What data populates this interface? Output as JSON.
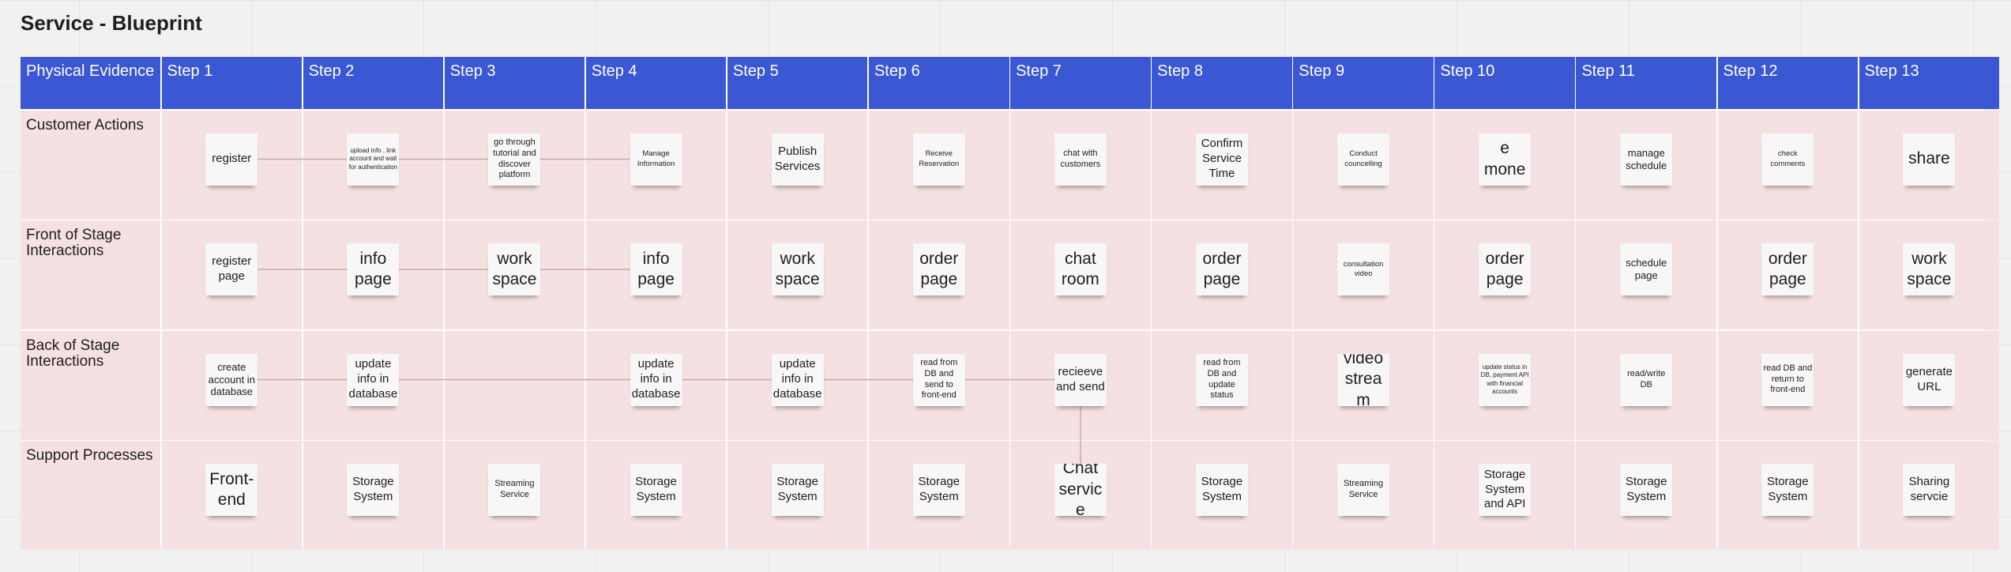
{
  "title": "Service - Blueprint",
  "corner_label": "Physical Evidence",
  "steps": [
    "Step 1",
    "Step 2",
    "Step 3",
    "Step 4",
    "Step 5",
    "Step 6",
    "Step 7",
    "Step 8",
    "Step 9",
    "Step 10",
    "Step 11",
    "Step 12",
    "Step 13"
  ],
  "rows": [
    {
      "label": "Customer Actions",
      "notes": [
        "register",
        "upload info , link account and wait for authentication",
        "go through tutorial and discover platform",
        "Manage Information",
        "Publish Services",
        "Receive Reservation",
        "chat with customers",
        "Confirm Service Time",
        "Conduct councelling",
        "receive money",
        "manage schedule",
        "check comments",
        "share"
      ]
    },
    {
      "label": "Front of Stage Interactions",
      "notes": [
        "register page",
        "info page",
        "work space",
        "info page",
        "work space",
        "order page",
        "chat room",
        "order page",
        "consultation video",
        "order page",
        "schedule page",
        "order page",
        "work space"
      ]
    },
    {
      "label": "Back of Stage Interactions",
      "notes": [
        "create account in database",
        "update info in database",
        "",
        "update info in database",
        "update info in database",
        "read from DB and send to front-end",
        "recieeve and send",
        "read from DB and update status",
        "video stream",
        "update status in DB, payment API with financial accounts",
        "read/write DB",
        "read DB and return to front-end",
        "generate URL"
      ]
    },
    {
      "label": "Support Processes",
      "notes": [
        "Front-end",
        "Storage System",
        "Streaming Service",
        "Storage System",
        "Storage System",
        "Storage System",
        "Chat service",
        "Storage System",
        "Streaming Service",
        "Storage System and API",
        "Storage System",
        "Storage System",
        "Sharing servcie"
      ]
    }
  ],
  "colors": {
    "header": "#3b57d3",
    "lane": "#f5e1e1",
    "note": "#f7f7f7",
    "connector": "#c9a8a8"
  }
}
